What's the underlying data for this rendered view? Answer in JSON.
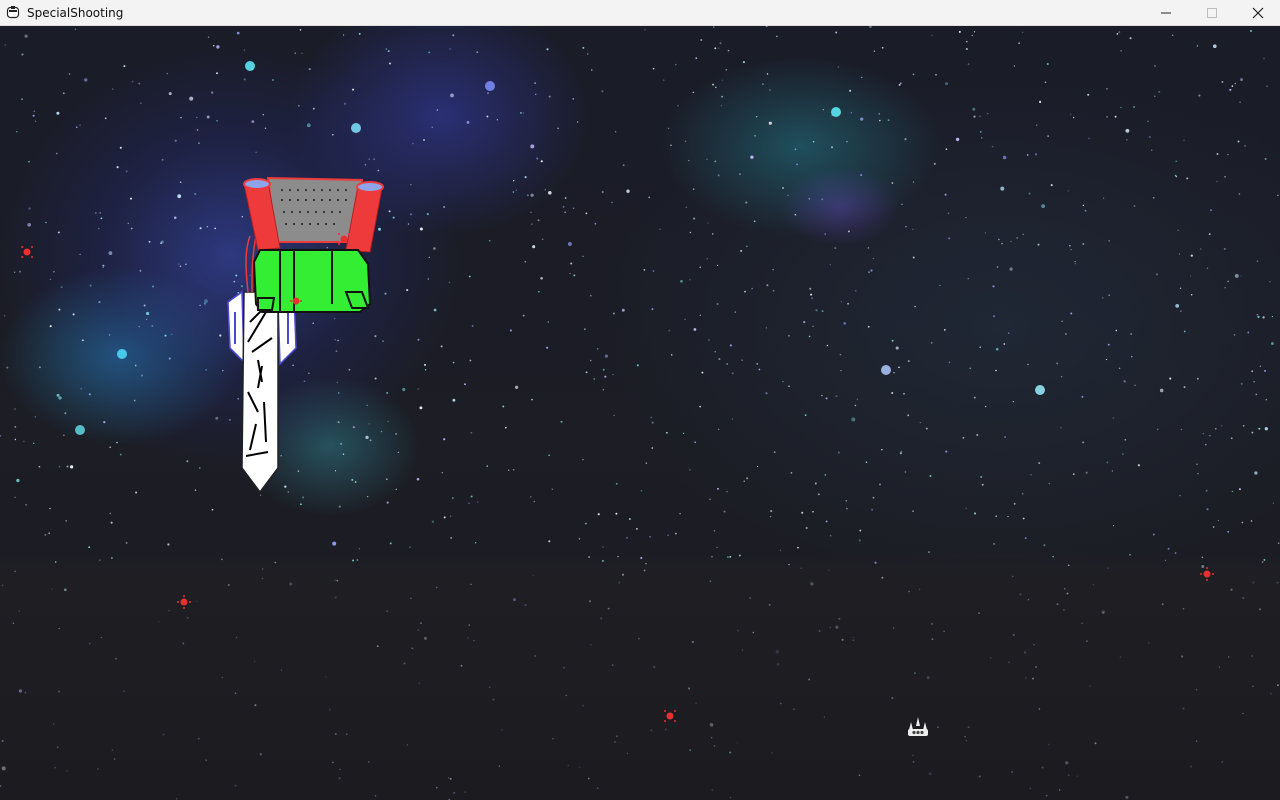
{
  "window": {
    "title": "SpecialShooting",
    "controls": {
      "minimize": "minimize",
      "maximize": "maximize",
      "close": "close"
    }
  },
  "game": {
    "background": "starfield-nebula",
    "boss": {
      "name": "boss-ship",
      "colors": {
        "cannons": "#ee3a3a",
        "cannon_tips": "#8fa4e8",
        "grille": "#8c8c8c",
        "hull": "#33ee33",
        "blade": "#ffffff",
        "blade_wings": "#4444cc",
        "scratches": "#000000"
      }
    },
    "player": {
      "name": "player-fighter",
      "color": "#eeeeee"
    },
    "enemy_bullets": {
      "count": 6,
      "color": "#e83030"
    }
  }
}
